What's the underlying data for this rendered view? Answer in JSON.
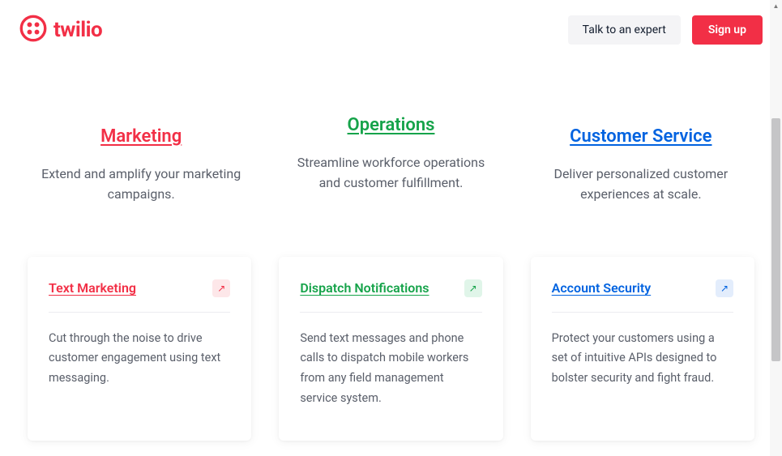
{
  "header": {
    "logo_text": "twilio",
    "expert_label": "Talk to an expert",
    "signup_label": "Sign up"
  },
  "columns": {
    "marketing": {
      "title": "Marketing",
      "desc": "Extend and amplify your marketing campaigns."
    },
    "operations": {
      "title": "Operations",
      "desc": "Streamline workforce operations and customer fulfillment."
    },
    "customer": {
      "title": "Customer Service",
      "desc": "Deliver personalized customer experiences at scale."
    }
  },
  "cards": {
    "marketing": {
      "title": "Text Marketing",
      "desc": "Cut through the noise to drive customer engagement using text messaging."
    },
    "operations": {
      "title": "Dispatch Notifications",
      "desc": "Send text messages and phone calls to dispatch mobile workers from any field management service system."
    },
    "customer": {
      "title": "Account Security",
      "desc": "Protect your customers using a set of intuitive APIs designed to bolster security and fight fraud."
    }
  }
}
